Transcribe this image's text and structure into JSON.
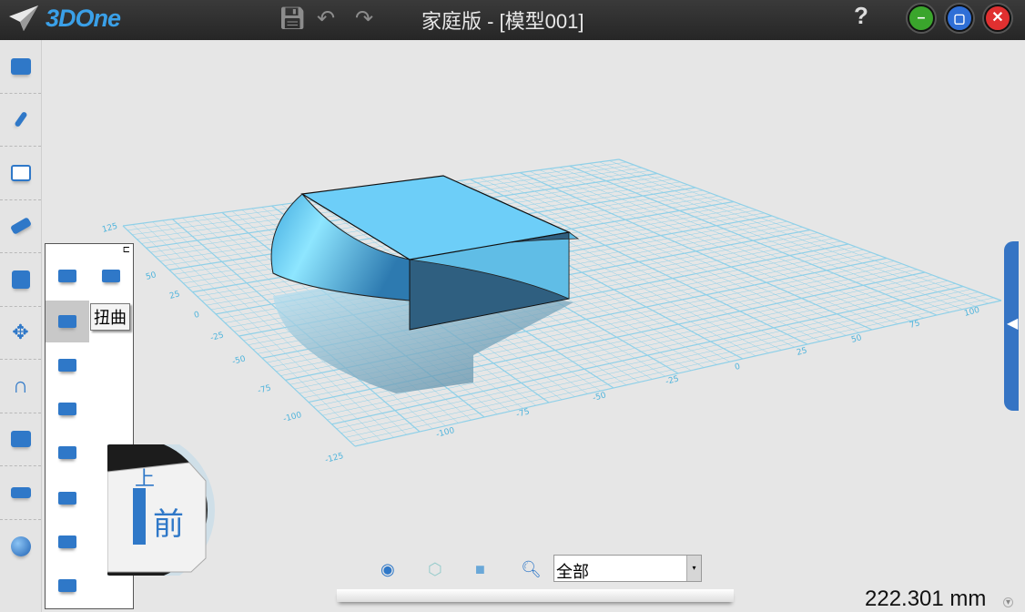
{
  "app": {
    "logo": "3DOne",
    "title": "家庭版 - [模型001]",
    "help": "?"
  },
  "toolbar": {
    "icons": [
      "save-icon",
      "undo-icon",
      "redo-icon"
    ]
  },
  "window_controls": {
    "minimize": "–",
    "maximize": "▢",
    "close": "✕",
    "colors": {
      "minimize": "#3aa52c",
      "maximize": "#2f6fd6",
      "close": "#e03030"
    }
  },
  "sidebar": {
    "items": [
      "basic-shapes",
      "sketch",
      "sketch-edit",
      "special-features",
      "combine",
      "move",
      "adsorb",
      "group",
      "measure",
      "render"
    ]
  },
  "flyout": {
    "pin": "⊏",
    "tooltip": "扭曲",
    "items": [
      "shell",
      "draw-surface",
      "twist",
      "bend",
      "inset",
      "wrap",
      "split",
      "loft",
      "taper"
    ],
    "selected": "twist"
  },
  "navcube": {
    "top": "上",
    "front": "前"
  },
  "grid": {
    "axis_left": [
      "125",
      "50",
      "25",
      "0",
      "-25",
      "-50",
      "-75",
      "-100",
      "-125"
    ],
    "axis_bottom": [
      "-100",
      "-75",
      "-50",
      "-25",
      "0",
      "25",
      "50",
      "75",
      "100"
    ]
  },
  "bottom": {
    "filter_value": "全部",
    "icons": [
      "eye-icon",
      "wireframe-icon",
      "shaded-icon",
      "zoom-fit-icon"
    ]
  },
  "status": {
    "measurement": "222.301 mm"
  },
  "colors": {
    "accent": "#2f78c8",
    "grid": "#8fd0e8",
    "model": "#6fd0f6"
  }
}
